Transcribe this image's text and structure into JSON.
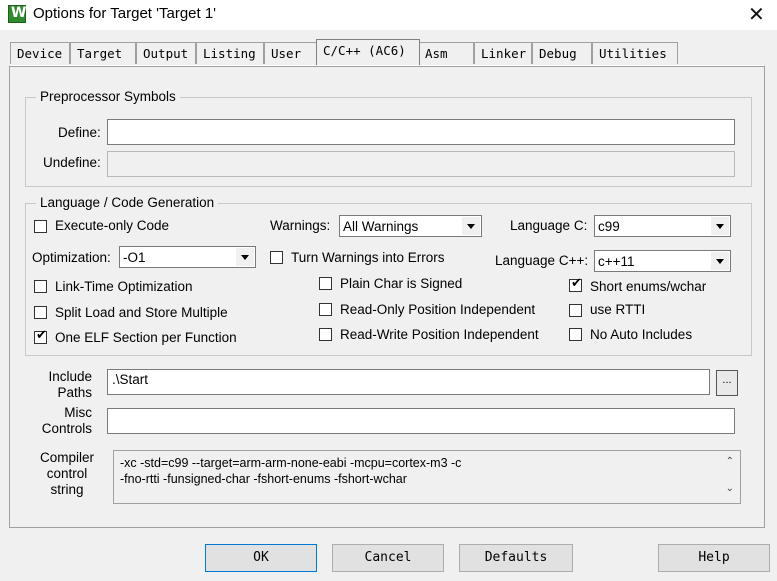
{
  "window": {
    "title": "Options for Target 'Target 1'",
    "close_glyph": "✕",
    "icon_letter": "W"
  },
  "tabs": [
    {
      "label": "Device"
    },
    {
      "label": "Target"
    },
    {
      "label": "Output"
    },
    {
      "label": "Listing"
    },
    {
      "label": "User"
    },
    {
      "label": "C/C++ (AC6)"
    },
    {
      "label": "Asm"
    },
    {
      "label": "Linker"
    },
    {
      "label": "Debug"
    },
    {
      "label": "Utilities"
    }
  ],
  "preprocessor": {
    "title": "Preprocessor Symbols",
    "define_label": "Define:",
    "define_value": "",
    "undefine_label": "Undefine:",
    "undefine_value": ""
  },
  "language": {
    "title": "Language / Code Generation",
    "execute_only": {
      "label": "Execute-only Code",
      "checked": false
    },
    "warnings_label": "Warnings:",
    "warnings_value": "All Warnings",
    "language_c_label": "Language C:",
    "language_c_value": "c99",
    "optimization_label": "Optimization:",
    "optimization_value": "-O1",
    "turn_warnings_errors": {
      "label": "Turn Warnings into Errors",
      "checked": false
    },
    "language_cpp_label": "Language C++:",
    "language_cpp_value": "c++11",
    "link_time": {
      "label": "Link-Time Optimization",
      "checked": false
    },
    "plain_char": {
      "label": "Plain Char is Signed",
      "checked": false
    },
    "short_enums": {
      "label": "Short enums/wchar",
      "checked": true
    },
    "split_load": {
      "label": "Split Load and Store Multiple",
      "checked": false
    },
    "ropi": {
      "label": "Read-Only Position Independent",
      "checked": false
    },
    "use_rtti": {
      "label": "use RTTI",
      "checked": false
    },
    "one_elf": {
      "label": "One ELF Section per Function",
      "checked": true
    },
    "rwpi": {
      "label": "Read-Write Position Independent",
      "checked": false
    },
    "no_auto_includes": {
      "label": "No Auto Includes",
      "checked": false
    },
    "check_mark": "✔"
  },
  "include_paths": {
    "label_line1": "Include",
    "label_line2": "Paths",
    "value": ".\\Start",
    "browse_label": "..."
  },
  "misc_controls": {
    "label_line1": "Misc",
    "label_line2": "Controls",
    "value": ""
  },
  "compiler_string": {
    "label_line1": "Compiler",
    "label_line2": "control",
    "label_line3": "string",
    "line1": "-xc -std=c99 --target=arm-arm-none-eabi -mcpu=cortex-m3 -c",
    "line2": "-fno-rtti -funsigned-char -fshort-enums -fshort-wchar",
    "scroll_up": "⌃",
    "scroll_down": "⌄"
  },
  "buttons": {
    "ok": "OK",
    "cancel": "Cancel",
    "defaults": "Defaults",
    "help": "Help"
  }
}
